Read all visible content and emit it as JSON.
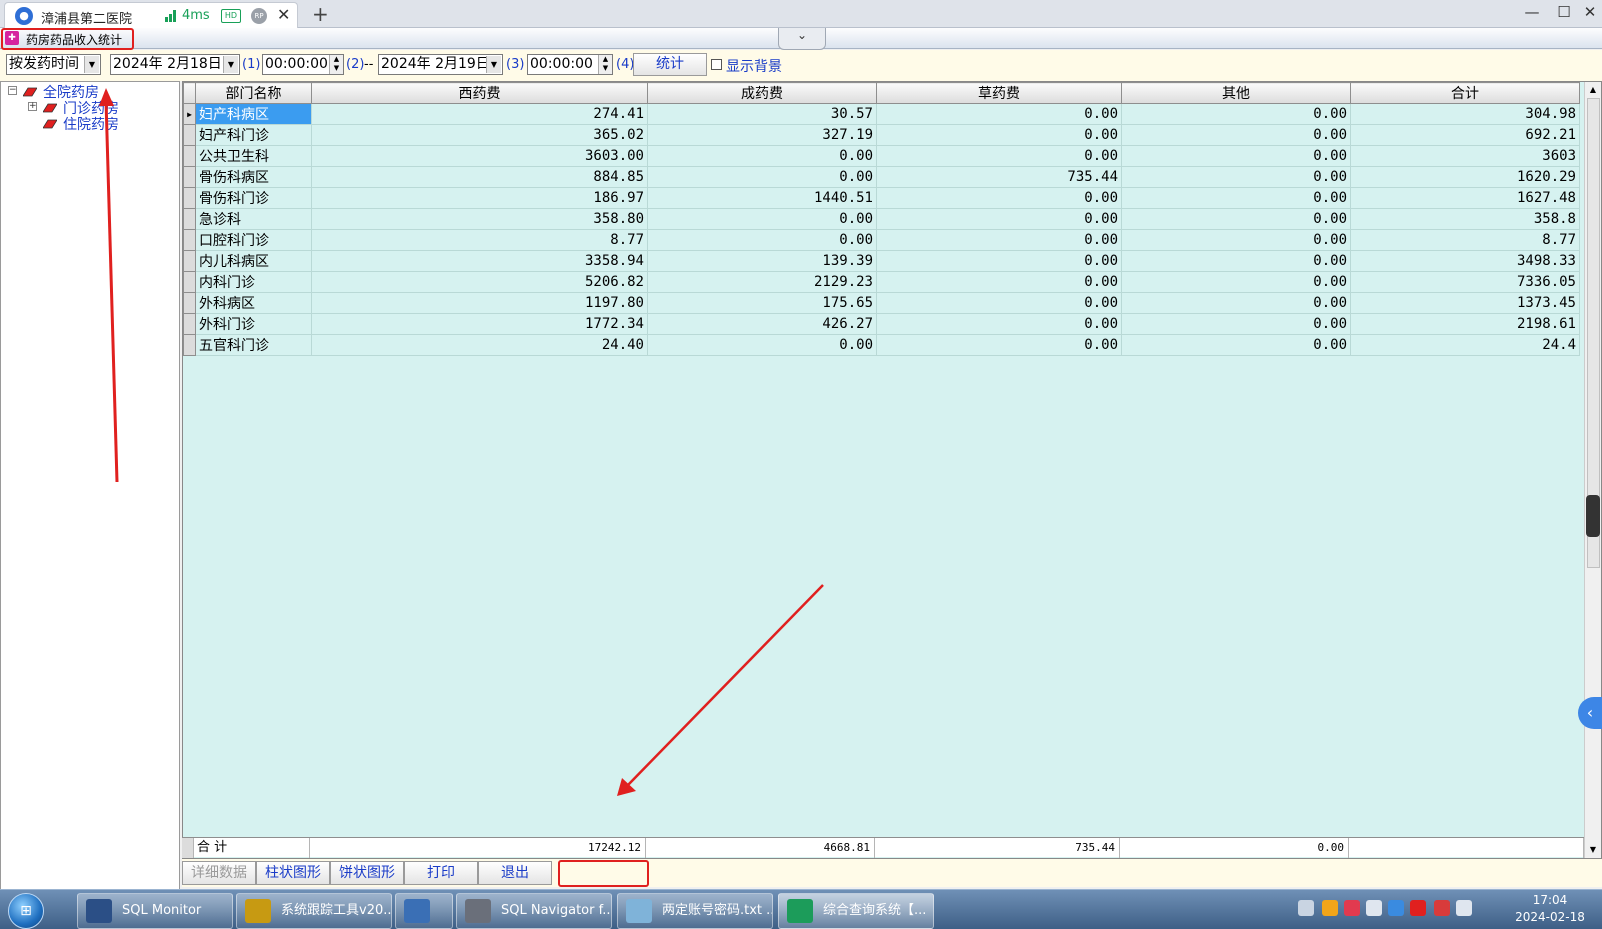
{
  "client": {
    "tab_title": "漳浦县第二医院",
    "latency": "4ms",
    "hd_badge": "HD",
    "rp_badge": "RP",
    "close_glyph": "✕",
    "add_glyph": "+"
  },
  "window": {
    "title": "药房药品收入统计",
    "app_icon": "hospital-icon"
  },
  "toolbar": {
    "mode_select": "按发药时间",
    "start_date": "2024年 2月18日",
    "start_time": "00:00:00",
    "label_1": "(1)",
    "label_2": "(2)",
    "separator": "--",
    "end_date": "2024年 2月19日",
    "label_3": "(3)",
    "end_time": "00:00:00",
    "label_4": "(4)",
    "stat_button": "统计",
    "show_bg_label": "显示背景",
    "show_bg_checked": false
  },
  "tree": {
    "root": "全院药房",
    "children": [
      "门诊药房",
      "住院药房"
    ]
  },
  "table": {
    "columns": [
      "部门名称",
      "西药费",
      "成药费",
      "草药费",
      "其他",
      "合计"
    ],
    "rows": [
      [
        "妇产科病区",
        "274.41",
        "30.57",
        "0.00",
        "0.00",
        "304.98"
      ],
      [
        "妇产科门诊",
        "365.02",
        "327.19",
        "0.00",
        "0.00",
        "692.21"
      ],
      [
        "公共卫生科",
        "3603.00",
        "0.00",
        "0.00",
        "0.00",
        "3603"
      ],
      [
        "骨伤科病区",
        "884.85",
        "0.00",
        "735.44",
        "0.00",
        "1620.29"
      ],
      [
        "骨伤科门诊",
        "186.97",
        "1440.51",
        "0.00",
        "0.00",
        "1627.48"
      ],
      [
        "急诊科",
        "358.80",
        "0.00",
        "0.00",
        "0.00",
        "358.8"
      ],
      [
        "口腔科门诊",
        "8.77",
        "0.00",
        "0.00",
        "0.00",
        "8.77"
      ],
      [
        "内儿科病区",
        "3358.94",
        "139.39",
        "0.00",
        "0.00",
        "3498.33"
      ],
      [
        "内科门诊",
        "5206.82",
        "2129.23",
        "0.00",
        "0.00",
        "7336.05"
      ],
      [
        "外科病区",
        "1197.80",
        "175.65",
        "0.00",
        "0.00",
        "1373.45"
      ],
      [
        "外科门诊",
        "1772.34",
        "426.27",
        "0.00",
        "0.00",
        "2198.61"
      ],
      [
        "五官科门诊",
        "24.40",
        "0.00",
        "0.00",
        "0.00",
        "24.4"
      ]
    ],
    "selected_row": 0,
    "footer": {
      "label": "合 计",
      "west": "17242.12",
      "patent": "4668.81",
      "herbal": "735.44",
      "other": "0.00",
      "total": ""
    }
  },
  "actions": {
    "detail": "详细数据",
    "bar_chart": "柱状图形",
    "pie_chart": "饼状图形",
    "print": "打印",
    "exit": "退出"
  },
  "taskbar": {
    "items": [
      {
        "label": "SQL Monitor",
        "icon": "sql-monitor-icon",
        "color": "#2b4f86"
      },
      {
        "label": "系统跟踪工具v20...",
        "icon": "sql-trace-icon",
        "color": "#c79a12"
      },
      {
        "label": "",
        "icon": "remote-desktop-icon",
        "color": "#3a6fb5"
      },
      {
        "label": "SQL Navigator f...",
        "icon": "navigator-icon",
        "color": "#6a6f7a"
      },
      {
        "label": "两定账号密码.txt ...",
        "icon": "notepad-icon",
        "color": "#7fb3d9"
      },
      {
        "label": "综合查询系统【...",
        "icon": "query-system-icon",
        "color": "#1c9c5a"
      }
    ],
    "clock_time": "17:04",
    "clock_date": "2024-02-18"
  },
  "colors": {
    "grid_bg": "#d6f2f0",
    "toolbar_bg": "#fffbe8",
    "link_blue": "#1a3cc8",
    "annotation_red": "#e0201f",
    "selection_blue": "#3b9cf0"
  }
}
